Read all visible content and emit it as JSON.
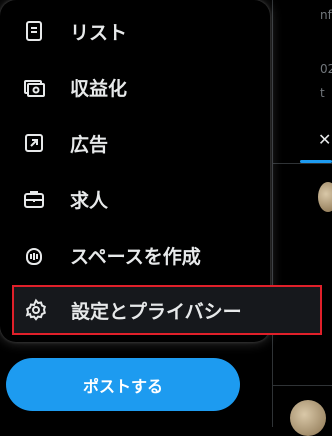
{
  "background": {
    "fragments": [
      "nf",
      "02",
      "t"
    ]
  },
  "menu": {
    "items": [
      {
        "label": "リスト",
        "icon": "list-icon"
      },
      {
        "label": "収益化",
        "icon": "monetization-icon"
      },
      {
        "label": "広告",
        "icon": "ads-icon"
      },
      {
        "label": "求人",
        "icon": "jobs-icon"
      },
      {
        "label": "スペースを作成",
        "icon": "spaces-icon"
      },
      {
        "label": "設定とプライバシー",
        "icon": "gear-icon"
      }
    ]
  },
  "post_button": {
    "label": "ポストする"
  },
  "colors": {
    "accent": "#1d9bf0",
    "highlight_border": "#e0202a",
    "text": "#e7e9ea"
  }
}
